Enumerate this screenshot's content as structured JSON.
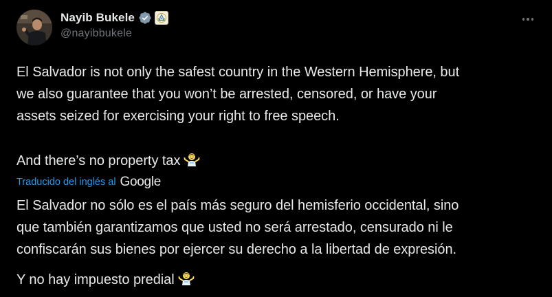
{
  "author": {
    "display_name": "Nayib Bukele",
    "handle": "@nayibbukele"
  },
  "icons": {
    "verified": "verified-badge-icon",
    "affiliation": "government-seal-icon",
    "more": "more-options-icon",
    "emoji": "person-shrugging-emoji",
    "accent_color": "#1d9bf0"
  },
  "tweet": {
    "original": {
      "lines": [
        "El Salvador is not only the safest country in the Western Hemisphere, but",
        "we also guarantee that you won’t be arrested, censored, or have your",
        "assets seized for exercising your right to free speech."
      ],
      "second_paragraph": "And there’s no property tax"
    },
    "translation_label": "Traducido del inglés al",
    "translation_provider": "Google",
    "translated": {
      "lines": [
        "El Salvador no sólo es el país más seguro del hemisferio occidental, sino",
        "que también garantizamos que usted no será arrestado, censurado ni le",
        "confiscarán sus bienes por ejercer su derecho a la libertad de expresión."
      ],
      "second_paragraph": "Y no hay impuesto predial"
    }
  }
}
